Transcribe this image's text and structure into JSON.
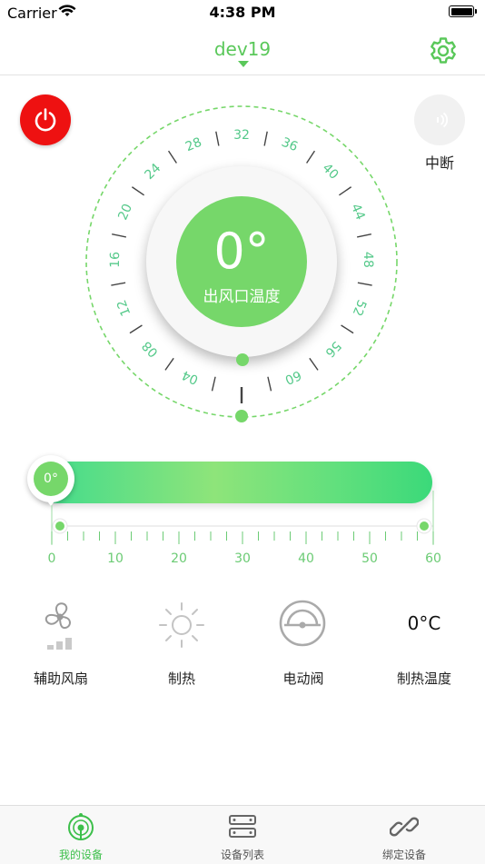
{
  "status_bar": {
    "carrier": "Carrier",
    "time": "4:38 PM"
  },
  "nav": {
    "title": "dev19",
    "settings_icon": "gear-icon"
  },
  "power": {
    "icon": "power-icon",
    "color": "#ee1111"
  },
  "interrupt": {
    "label": "中断",
    "icon": "signal-icon"
  },
  "dial": {
    "value": "0°",
    "label": "出风口温度",
    "ticks": [
      "04",
      "08",
      "12",
      "16",
      "20",
      "24",
      "28",
      "32",
      "36",
      "40",
      "44",
      "48",
      "52",
      "56",
      "60"
    ],
    "accent": "#76d76a",
    "tick_color": "#55c98a"
  },
  "slider": {
    "value_label": "0°",
    "value": 0,
    "min": 0,
    "max": 60,
    "scale_labels": [
      "0",
      "10",
      "20",
      "30",
      "40",
      "50",
      "60"
    ]
  },
  "functions": [
    {
      "label": "辅助风扇",
      "icon": "fan-icon"
    },
    {
      "label": "制热",
      "icon": "sun-icon"
    },
    {
      "label": "电动阀",
      "icon": "valve-icon"
    },
    {
      "label": "制热温度",
      "value": "0°C"
    }
  ],
  "tabs": [
    {
      "label": "我的设备",
      "icon": "my-device-icon",
      "active": true
    },
    {
      "label": "设备列表",
      "icon": "device-list-icon",
      "active": false
    },
    {
      "label": "绑定设备",
      "icon": "link-icon",
      "active": false
    }
  ],
  "colors": {
    "accent": "#5ac85a",
    "active_tab": "#3cbf4a",
    "inactive_tab": "#555555"
  }
}
